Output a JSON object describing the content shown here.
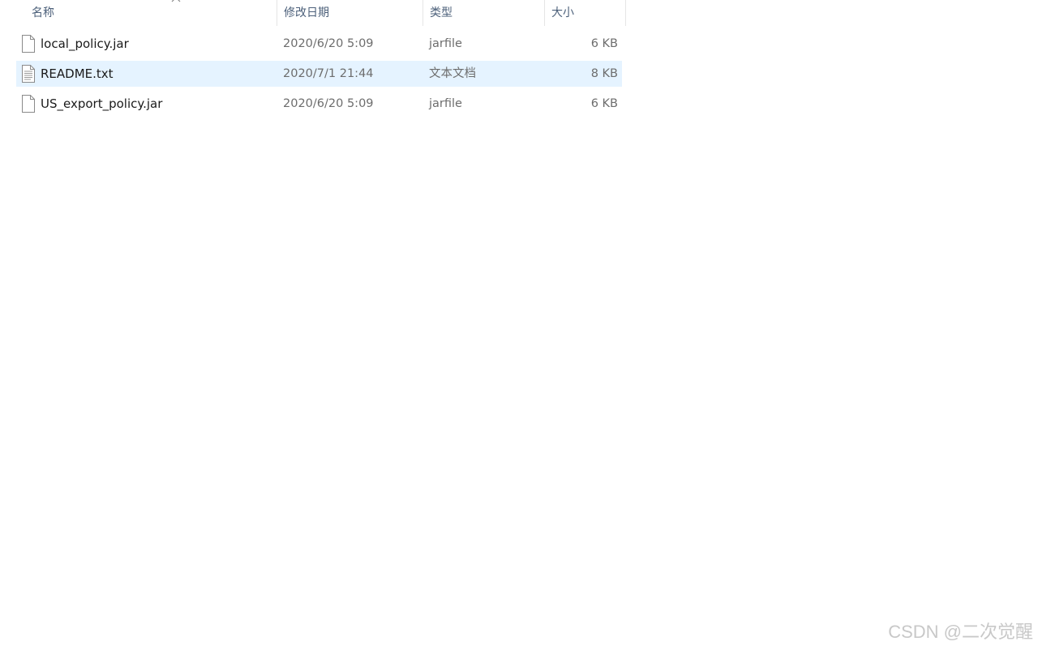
{
  "columns": {
    "name": "名称",
    "date": "修改日期",
    "type": "类型",
    "size": "大小"
  },
  "sort": {
    "column": "name",
    "direction": "ascending",
    "icon": "chevron-up-icon"
  },
  "files": [
    {
      "name": "local_policy.jar",
      "date": "2020/6/20 5:09",
      "type": "jarfile",
      "size": "6 KB",
      "icon": "file-icon",
      "selected": false
    },
    {
      "name": "README.txt",
      "date": "2020/7/1 21:44",
      "type": "文本文档",
      "size": "8 KB",
      "icon": "text-file-icon",
      "selected": true
    },
    {
      "name": "US_export_policy.jar",
      "date": "2020/6/20 5:09",
      "type": "jarfile",
      "size": "6 KB",
      "icon": "file-icon",
      "selected": false
    }
  ],
  "watermark": "CSDN @二次觉醒",
  "colors": {
    "selection": "#e5f3ff",
    "header_text": "#4c607a",
    "secondary_text": "#6d6d6d"
  }
}
